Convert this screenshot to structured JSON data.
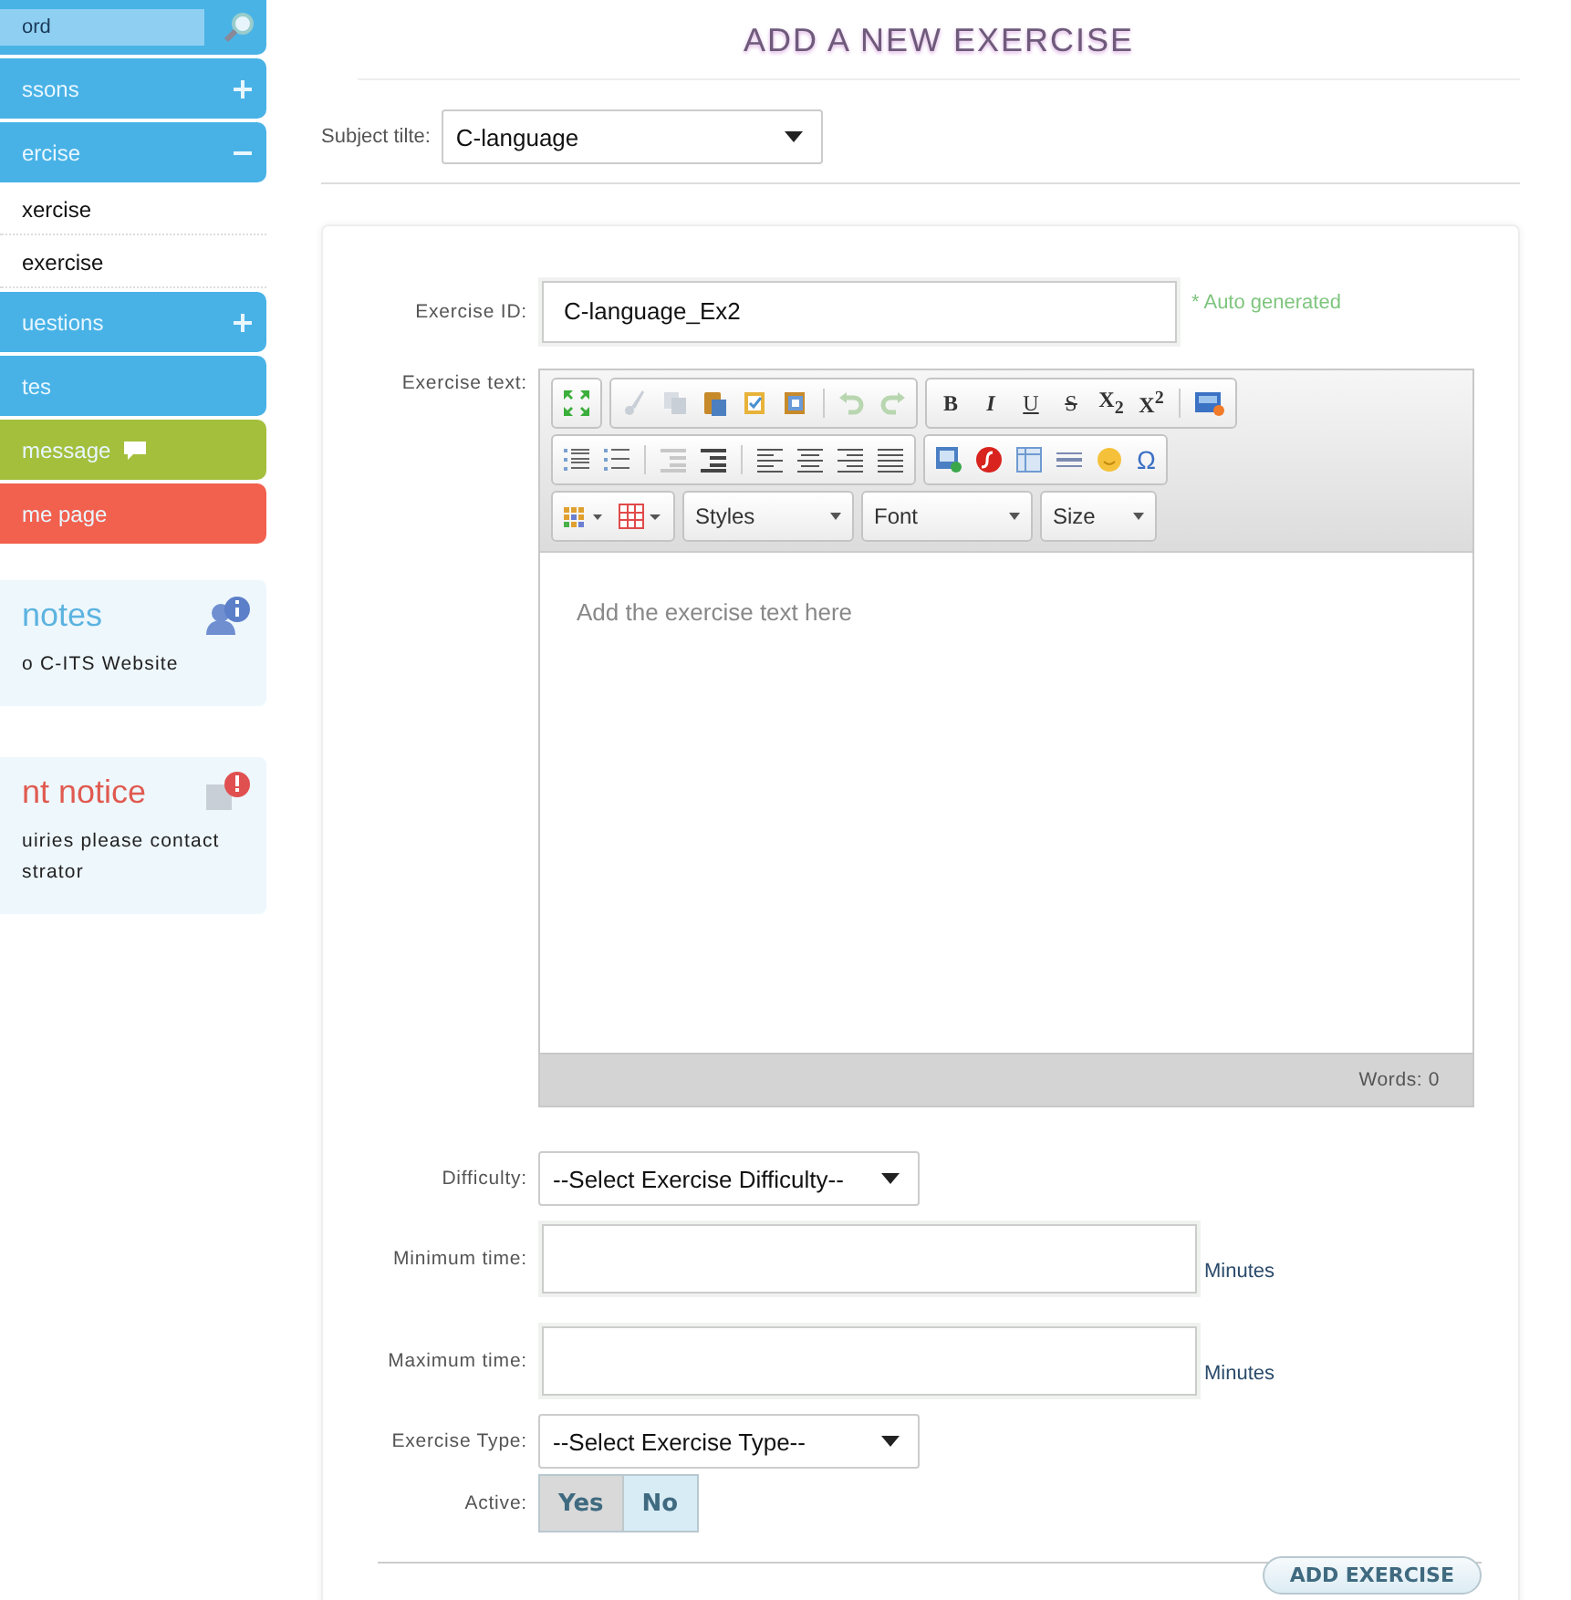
{
  "sidebar": {
    "search": {
      "value": "ord"
    },
    "items": [
      {
        "kind": "group",
        "label": "ssons",
        "expanded": false,
        "color": "#48b2e6"
      },
      {
        "kind": "group",
        "label": "ercise",
        "expanded": true,
        "color": "#48b2e6",
        "children": [
          {
            "label": "xercise"
          },
          {
            "label": "exercise"
          }
        ]
      },
      {
        "kind": "group",
        "label": "uestions",
        "expanded": false,
        "color": "#48b2e6"
      },
      {
        "kind": "link",
        "label": "tes",
        "color": "#48b2e6"
      },
      {
        "kind": "message",
        "label": "message",
        "color": "#a4bf3c"
      },
      {
        "kind": "link",
        "label": "me page",
        "color": "#f2604e"
      }
    ],
    "panels": [
      {
        "kind": "info",
        "title": "notes",
        "text": "o C-ITS Website"
      },
      {
        "kind": "alert",
        "title": "nt notice",
        "text": "uiries please contact strator"
      }
    ]
  },
  "page_title": "ADD A NEW EXERCISE",
  "subject": {
    "label": "Subject tilte:",
    "value": "C-language"
  },
  "form": {
    "exercise_id": {
      "label": "Exercise ID:",
      "value": "C-language_Ex2",
      "hint": "* Auto generated"
    },
    "exercise_text": {
      "label": "Exercise text:",
      "format_buttons": [
        "B",
        "I",
        "U",
        "S",
        "X$_{2}$",
        "X$^{2}$"
      ],
      "special_char": "Ω",
      "dropdowns": [
        "Styles",
        "Font",
        "Size"
      ],
      "placeholder": "Add the exercise text here",
      "word_count": "Words: 0"
    },
    "difficulty": {
      "label": "Difficulty:",
      "value": "--Select Exercise Difficulty--"
    },
    "minimum_time": {
      "label": "Minimum time:",
      "unit": "Minutes"
    },
    "maximum_time": {
      "label": "Maximum time:",
      "unit": "Minutes"
    },
    "exercise_type": {
      "label": "Exercise Type:",
      "value": "--Select Exercise Type--"
    },
    "active": {
      "label": "Active:",
      "options": [
        {
          "label": "Yes",
          "selected": true
        },
        {
          "label": "No",
          "selected": false
        }
      ]
    },
    "submit": "ADD EXERCISE"
  }
}
